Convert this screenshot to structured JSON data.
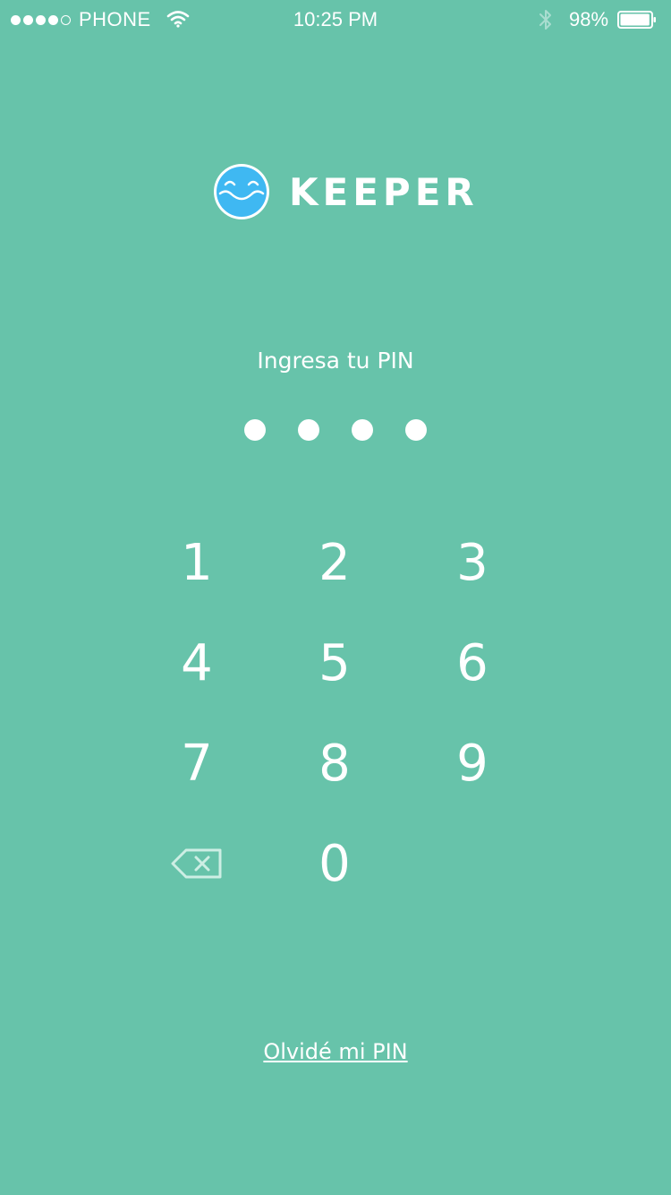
{
  "status_bar": {
    "carrier": "PHONE",
    "time": "10:25 PM",
    "battery_percent": "98%",
    "signal_strength": "4 of 5",
    "battery_level": 0.98
  },
  "app": {
    "name": "KEEPER",
    "logo_icon": "smiling-face-icon",
    "logo_color": "#3fb8f2"
  },
  "pin": {
    "prompt": "Ingresa tu PIN",
    "entered_digits": 4
  },
  "keypad": {
    "keys": [
      "1",
      "2",
      "3",
      "4",
      "5",
      "6",
      "7",
      "8",
      "9",
      "0"
    ],
    "delete_icon": "backspace-icon"
  },
  "footer": {
    "forgot_link": "Olvidé mi PIN"
  },
  "colors": {
    "background": "#67c3aa",
    "foreground": "#ffffff"
  }
}
